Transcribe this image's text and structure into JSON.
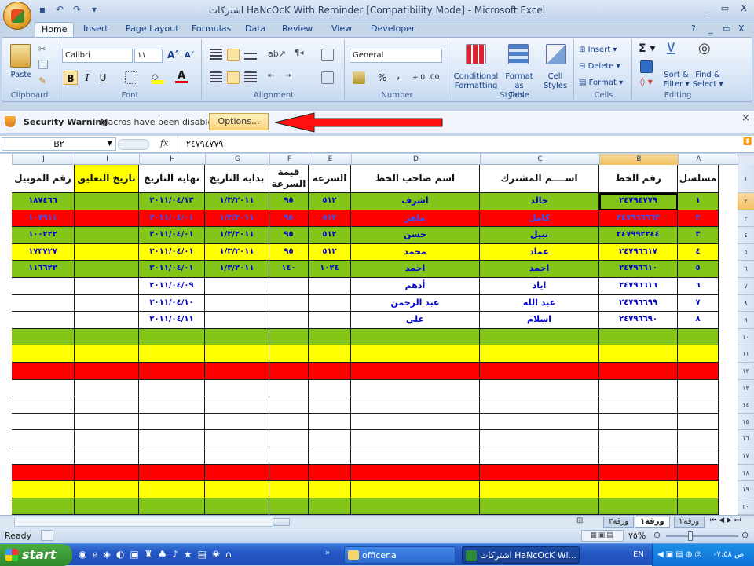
{
  "window": {
    "title": "اشتركات HaNcOcK With Reminder  [Compatibility Mode] - Microsoft Excel",
    "min": "_",
    "restore": "▭",
    "close": "X"
  },
  "ribbon": {
    "tabs": [
      "Home",
      "Insert",
      "Page Layout",
      "Formulas",
      "Data",
      "Review",
      "View",
      "Developer"
    ],
    "active_tab": "Home",
    "groups": {
      "clipboard": {
        "label": "Clipboard",
        "paste": "Paste"
      },
      "font": {
        "label": "Font",
        "name": "Calibri",
        "size": "١١",
        "bold": "B",
        "italic": "I",
        "underline": "U"
      },
      "alignment": {
        "label": "Alignment"
      },
      "number": {
        "label": "Number",
        "format": "General",
        "percent": "%",
        "comma": ","
      },
      "styles": {
        "label": "Styles",
        "conditional_1": "Conditional",
        "conditional_2": "Formatting",
        "format_table_1": "Format as",
        "format_table_2": "Table",
        "cell_styles_1": "Cell",
        "cell_styles_2": "Styles"
      },
      "cells": {
        "label": "Cells",
        "insert": "Insert",
        "delete": "Delete",
        "format": "Format"
      },
      "editing": {
        "label": "Editing",
        "sort_1": "Sort &",
        "sort_2": "Filter",
        "find_1": "Find &",
        "find_2": "Select"
      }
    }
  },
  "security": {
    "title": "Security Warning",
    "message": "Macros have been disabled.",
    "options": "Options..."
  },
  "formula_bar": {
    "name_box": "B٢",
    "fx": "fx",
    "value": "٢٤٧٩٤٧٧٩"
  },
  "columns": [
    "J",
    "I",
    "H",
    "G",
    "F",
    "E",
    "D",
    "C",
    "B",
    "A"
  ],
  "selected_column": "B",
  "selected_row": "٢",
  "colors": {
    "green": "#84c51a",
    "red": "#ff0000",
    "yellow": "#ffff00",
    "white": "#ffffff",
    "text_blue": "#0000cc",
    "selection": "#f4c566"
  },
  "header_row": [
    "رقم الموبيل",
    "تاريخ التعليق",
    "نهاية التاريخ",
    "بداية التاريخ",
    "قيمة السرعة",
    "السرعة",
    "اسم صاحب الخط",
    "اســــم المشترك",
    "رقم الخط",
    "مسلسل"
  ],
  "rows": [
    {
      "n": "٢",
      "fill": "green",
      "cells": [
        "١٨٧٤٦٦",
        "",
        "٢٠١١/٠٤/١٣",
        "١/٣/٢٠١١",
        "٩٥",
        "٥١٢",
        "اشرف",
        "خالد",
        "٢٤٧٩٤٧٧٩",
        "١"
      ]
    },
    {
      "n": "٣",
      "fill": "red",
      "cells": [
        "١٠٧٩١١",
        "",
        "٢٠١١/٠٤/٠١",
        "١/٣/٢٠١١",
        "٩٥",
        "٥١٢",
        "ماهر",
        "كامل",
        "٢٤٧٩٦٦٦٦٣",
        "٢"
      ]
    },
    {
      "n": "٤",
      "fill": "green",
      "cells": [
        "١٠٠٢٢٢",
        "",
        "٢٠١١/٠٤/٠١",
        "١/٣/٢٠١١",
        "٩٥",
        "٥١٢",
        "حسن",
        "نبيل",
        "٢٤٧٩٩٢٢٤٤",
        "٣"
      ]
    },
    {
      "n": "٥",
      "fill": "yellow",
      "cells": [
        "١٧٣٧٢٧",
        "",
        "٢٠١١/٠٤/٠١",
        "١/٣/٢٠١١",
        "٩٥",
        "٥١٢",
        "محمد",
        "عماد",
        "٢٤٧٩٦٦١٧",
        "٤"
      ]
    },
    {
      "n": "٦",
      "fill": "green",
      "cells": [
        "١١٦٦٢٢",
        "",
        "٢٠١١/٠٤/٠١",
        "١/٣/٢٠١١",
        "١٤٠",
        "١٠٢٤",
        "احمد",
        "احمد",
        "٢٤٧٩٦٦١٠",
        "٥"
      ]
    },
    {
      "n": "٧",
      "fill": "white",
      "cells": [
        "",
        "",
        "٢٠١١/٠٤/٠٩",
        "",
        "",
        "",
        "أدهم",
        "اياد",
        "٢٤٧٩٦٦١٦",
        "٦"
      ]
    },
    {
      "n": "٨",
      "fill": "white",
      "cells": [
        "",
        "",
        "٢٠١١/٠٤/١٠",
        "",
        "",
        "",
        "عبد الرحمن",
        "عبد الله",
        "٢٤٧٩٦٦٩٩",
        "٧"
      ]
    },
    {
      "n": "٩",
      "fill": "white",
      "cells": [
        "",
        "",
        "٢٠١١/٠٤/١١",
        "",
        "",
        "",
        "علي",
        "اسلام",
        "٢٤٧٩٦٦٩٠",
        "٨"
      ]
    },
    {
      "n": "١٠",
      "fill": "green",
      "cells": [
        "",
        "",
        "",
        "",
        "",
        "",
        "",
        "",
        "",
        ""
      ]
    },
    {
      "n": "١١",
      "fill": "yellow",
      "cells": [
        "",
        "",
        "",
        "",
        "",
        "",
        "",
        "",
        "",
        ""
      ]
    },
    {
      "n": "١٢",
      "fill": "red",
      "cells": [
        "",
        "",
        "",
        "",
        "",
        "",
        "",
        "",
        "",
        ""
      ]
    },
    {
      "n": "١٣",
      "fill": "white",
      "cells": [
        "",
        "",
        "",
        "",
        "",
        "",
        "",
        "",
        "",
        ""
      ]
    },
    {
      "n": "١٤",
      "fill": "white",
      "cells": [
        "",
        "",
        "",
        "",
        "",
        "",
        "",
        "",
        "",
        ""
      ]
    },
    {
      "n": "١٥",
      "fill": "white",
      "cells": [
        "",
        "",
        "",
        "",
        "",
        "",
        "",
        "",
        "",
        ""
      ]
    },
    {
      "n": "١٦",
      "fill": "white",
      "cells": [
        "",
        "",
        "",
        "",
        "",
        "",
        "",
        "",
        "",
        ""
      ]
    },
    {
      "n": "١٧",
      "fill": "white",
      "cells": [
        "",
        "",
        "",
        "",
        "",
        "",
        "",
        "",
        "",
        ""
      ]
    },
    {
      "n": "١٨",
      "fill": "red",
      "cells": [
        "",
        "",
        "",
        "",
        "",
        "",
        "",
        "",
        "",
        ""
      ]
    },
    {
      "n": "١٩",
      "fill": "yellow",
      "cells": [
        "",
        "",
        "",
        "",
        "",
        "",
        "",
        "",
        "",
        ""
      ]
    },
    {
      "n": "٢٠",
      "fill": "green",
      "cells": [
        "",
        "",
        "",
        "",
        "",
        "",
        "",
        "",
        "",
        ""
      ]
    }
  ],
  "sheet_tabs": [
    "ورقة٣",
    "ورقة١",
    "ورقة٢"
  ],
  "active_sheet": "ورقة١",
  "status": {
    "ready": "Ready",
    "zoom": "٧٥%"
  },
  "taskbar": {
    "start": "start",
    "folder": "officena",
    "excel": "اشتركات HaNcOcK Wi...",
    "lang": "EN",
    "clock": "ص ٠٧:٥٨"
  }
}
